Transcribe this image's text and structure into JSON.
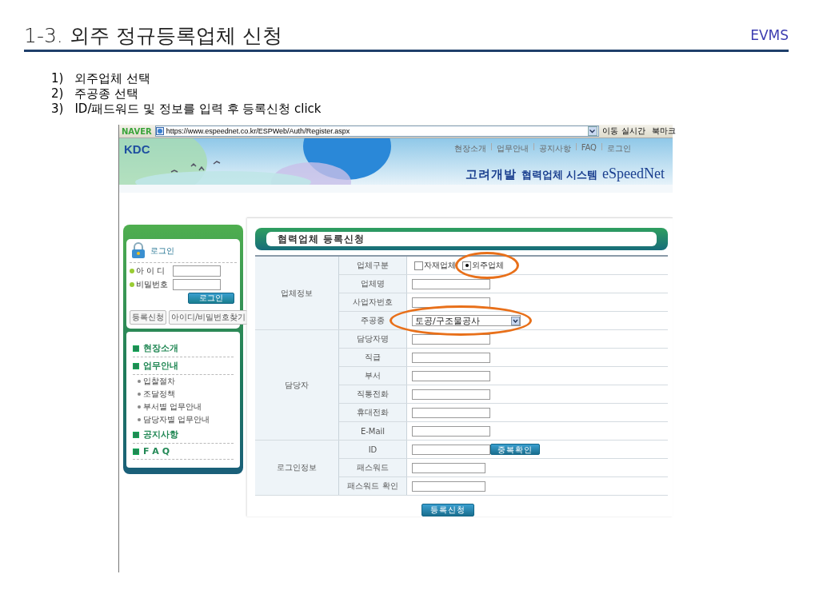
{
  "slide": {
    "title": "1-3. 외주 정규등록업체 신청",
    "brand": "EVMS",
    "steps": [
      {
        "number": "1)",
        "text": "외주업체 선택"
      },
      {
        "number": "2)",
        "text": "주공종 선택"
      },
      {
        "number": "3)",
        "text": "ID/패드워드 및 정보를 입력 후 등록신청 click"
      }
    ]
  },
  "browser": {
    "logo": "NAVER",
    "url": "https://www.espeednet.co.kr/ESPWeb/Auth/Register.aspx",
    "go": "이동",
    "realtime": "실시간",
    "bookmarks": "북마크"
  },
  "site": {
    "logo": "KDC",
    "top_nav": [
      "현장소개",
      "업무안내",
      "공지사항",
      "FAQ",
      "로그인"
    ],
    "company": "고려개발",
    "system": "협력업체 시스템",
    "product": "eSpeedNet"
  },
  "sidebar": {
    "login_title": "로그인",
    "id_label": "아 이 디",
    "pw_label": "비밀번호",
    "login_button": "로그인",
    "links": [
      "등록신청",
      "아이디/비밀번호찾기"
    ],
    "menu": [
      {
        "label": "현장소개"
      },
      {
        "label": "업무안내",
        "children": [
          {
            "label": "입찰절차"
          },
          {
            "label": "조달정책"
          },
          {
            "label": "부서별 업무안내"
          },
          {
            "label": "담당자별 업무안내"
          }
        ]
      },
      {
        "label": "공지사항"
      },
      {
        "label": "F A Q"
      }
    ]
  },
  "form": {
    "title": "협력업체 등록신청",
    "sections": [
      {
        "label": "업체정보",
        "rows": [
          {
            "label": "업체구분",
            "kind": "radio",
            "highlighted": false,
            "options": [
              {
                "label": "자재업체",
                "selected": false,
                "highlighted": false
              },
              {
                "label": "외주업체",
                "selected": true,
                "highlighted": true
              }
            ]
          },
          {
            "label": "업체명",
            "kind": "text",
            "highlighted": false
          },
          {
            "label": "사업자번호",
            "kind": "text",
            "highlighted": false
          },
          {
            "label": "주공종",
            "kind": "select",
            "value": "토공/구조물공사",
            "highlighted": true
          }
        ]
      },
      {
        "label": "담당자",
        "rows": [
          {
            "label": "담당자명",
            "kind": "text",
            "highlighted": false
          },
          {
            "label": "직급",
            "kind": "text",
            "highlighted": false
          },
          {
            "label": "부서",
            "kind": "text",
            "highlighted": false
          },
          {
            "label": "직통전화",
            "kind": "text",
            "highlighted": false
          },
          {
            "label": "휴대전화",
            "kind": "text",
            "highlighted": false
          },
          {
            "label": "E-Mail",
            "kind": "text",
            "highlighted": false
          }
        ]
      },
      {
        "label": "로그인정보",
        "rows": [
          {
            "label": "ID",
            "kind": "text_button",
            "button": "중복확인",
            "highlighted": false
          },
          {
            "label": "패스워드",
            "kind": "password",
            "highlighted": false
          },
          {
            "label": "패스워드 확인",
            "kind": "password",
            "highlighted": false
          }
        ]
      }
    ],
    "submit": "등록신청"
  }
}
